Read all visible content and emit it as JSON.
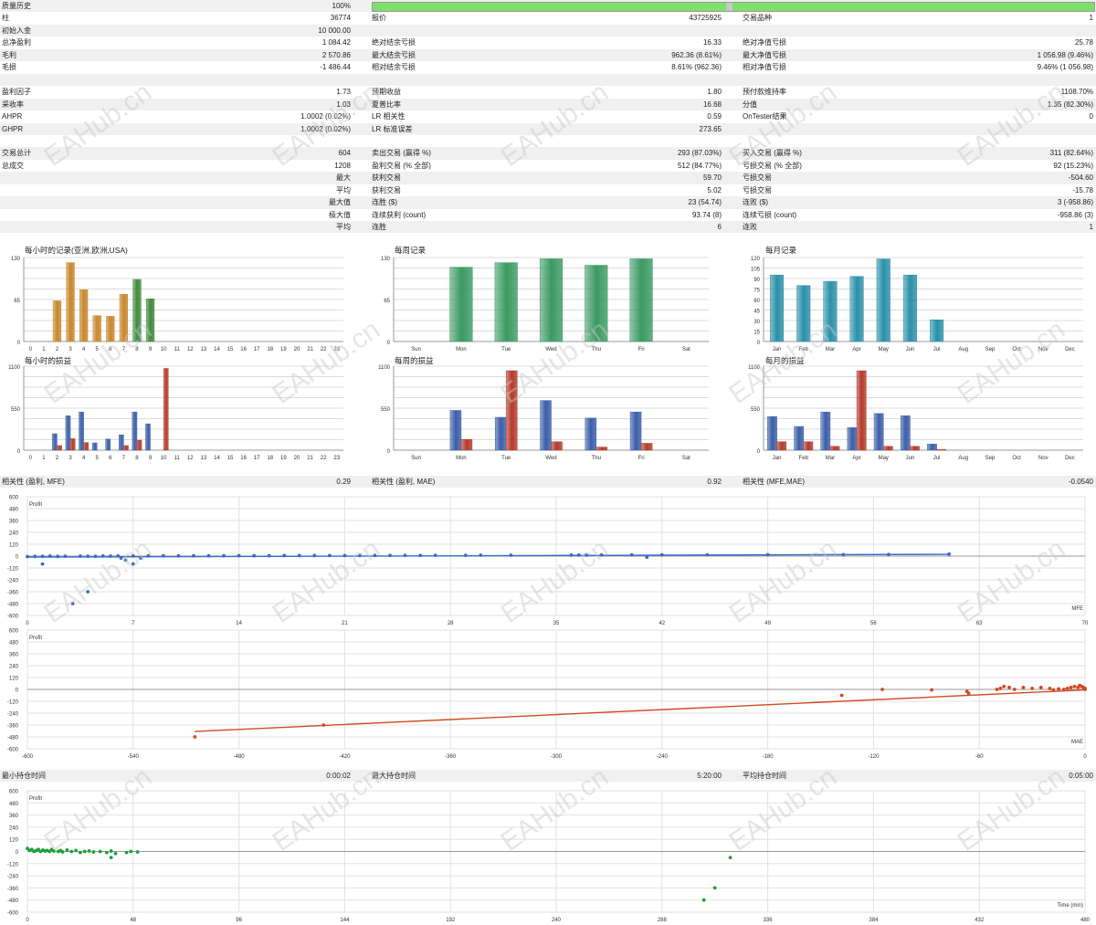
{
  "stats_rows": [
    {
      "cells": [
        [
          "质量历史",
          "100%"
        ],
        [
          "",
          ""
        ],
        [
          "",
          ""
        ]
      ],
      "alt": true
    },
    {
      "cells": [
        [
          "柱",
          "36774"
        ],
        [
          "报价",
          "43725925"
        ],
        [
          "交易品种",
          "1"
        ]
      ],
      "alt": false
    },
    {
      "cells": [
        [
          "初始入金",
          "10 000.00"
        ],
        [
          "",
          ""
        ],
        [
          "",
          ""
        ]
      ],
      "alt": true
    },
    {
      "cells": [
        [
          "总净盈利",
          "1 084.42"
        ],
        [
          "绝对结余亏损",
          "16.33"
        ],
        [
          "绝对净值亏损",
          "25.78"
        ]
      ],
      "alt": false
    },
    {
      "cells": [
        [
          "毛利",
          "2 570.86"
        ],
        [
          "最大结余亏损",
          "962.36 (8.61%)"
        ],
        [
          "最大净值亏损",
          "1 056.98 (9.46%)"
        ]
      ],
      "alt": true
    },
    {
      "cells": [
        [
          "毛损",
          "-1 486.44"
        ],
        [
          "相对结余亏损",
          "8.61% (962.36)"
        ],
        [
          "相对净值亏损",
          "9.46% (1 056.98)"
        ]
      ],
      "alt": false
    },
    {
      "cells": [
        [
          "",
          ""
        ],
        [
          "",
          ""
        ],
        [
          "",
          ""
        ]
      ],
      "alt": true
    },
    {
      "cells": [
        [
          "盈利因子",
          "1.73"
        ],
        [
          "预期收益",
          "1.80"
        ],
        [
          "预付款维持率",
          "1108.70%"
        ]
      ],
      "alt": false
    },
    {
      "cells": [
        [
          "采收率",
          "1.03"
        ],
        [
          "夏普比率",
          "16.68"
        ],
        [
          "分值",
          "1.35 (82.30%)"
        ]
      ],
      "alt": true
    },
    {
      "cells": [
        [
          "AHPR",
          "1.0002 (0.02%)"
        ],
        [
          "LR 相关性",
          "0.59"
        ],
        [
          "OnTester结果",
          "0"
        ]
      ],
      "alt": false
    },
    {
      "cells": [
        [
          "GHPR",
          "1.0002 (0.02%)"
        ],
        [
          "LR 标准误差",
          "273.65"
        ],
        [
          "",
          ""
        ]
      ],
      "alt": true
    },
    {
      "cells": [
        [
          "",
          ""
        ],
        [
          "",
          ""
        ],
        [
          "",
          ""
        ]
      ],
      "alt": false
    },
    {
      "cells": [
        [
          "交易总计",
          "604"
        ],
        [
          "卖出交易 (赢得 %)",
          "293 (87.03%)"
        ],
        [
          "买入交易 (赢得 %)",
          "311 (82.64%)"
        ]
      ],
      "alt": true
    },
    {
      "cells": [
        [
          "总成交",
          "1208"
        ],
        [
          "盈利交易 (% 全部)",
          "512 (84.77%)"
        ],
        [
          "亏损交易 (% 全部)",
          "92 (15.23%)"
        ]
      ],
      "alt": false
    },
    {
      "cells": [
        [
          "",
          "最大"
        ],
        [
          "获利交易",
          "59.70"
        ],
        [
          "亏损交易",
          "-504.60"
        ]
      ],
      "alt": true
    },
    {
      "cells": [
        [
          "",
          "平均"
        ],
        [
          "获利交易",
          "5.02"
        ],
        [
          "亏损交易",
          "-15.78"
        ]
      ],
      "alt": false
    },
    {
      "cells": [
        [
          "",
          "最大值"
        ],
        [
          "连胜 ($)",
          "23 (54.74)"
        ],
        [
          "连败 ($)",
          "3 (-958.86)"
        ]
      ],
      "alt": true
    },
    {
      "cells": [
        [
          "",
          "极大值"
        ],
        [
          "连续获利 (count)",
          "93.74 (8)"
        ],
        [
          "连续亏损 (count)",
          "-958.86 (3)"
        ]
      ],
      "alt": false
    },
    {
      "cells": [
        [
          "",
          "平均"
        ],
        [
          "连胜",
          "6"
        ],
        [
          "连败",
          "1"
        ]
      ],
      "alt": true
    }
  ],
  "quality_fill_percent": 100,
  "charts_top": {
    "titles": [
      "每小时的记录(亚洲,欧洲,USA)",
      "每周记录",
      "每月记录"
    ],
    "titles2": [
      "每小时的损益",
      "每周的损益",
      "每月的损益"
    ]
  },
  "chart_data": [
    {
      "type": "bar",
      "name_id": "hourly-records",
      "categories": [
        "0",
        "1",
        "2",
        "3",
        "4",
        "5",
        "6",
        "7",
        "8",
        "9",
        "10",
        "11",
        "12",
        "13",
        "14",
        "15",
        "16",
        "17",
        "18",
        "19",
        "20",
        "21",
        "22",
        "23"
      ],
      "values": [
        0,
        0,
        63,
        122,
        80,
        40,
        39,
        73,
        96,
        66,
        0,
        0,
        0,
        0,
        0,
        0,
        0,
        0,
        0,
        0,
        0,
        0,
        0,
        0
      ],
      "colors": [
        "#c8862a",
        "#c8862a",
        "#c8862a",
        "#c8862a",
        "#c8862a",
        "#c8862a",
        "#c8862a",
        "#c8862a",
        "#3d8a3d",
        "#3d8a3d",
        "#3d8a3d",
        "#3d8a3d",
        "#3d8a3d",
        "#3d8a3d",
        "#3d8a3d",
        "#3d8a3d",
        "#3d8a3d",
        "#3d8a3d",
        "#3d8a3d",
        "#3d8a3d",
        "#3d8a3d",
        "#3d8a3d",
        "#3d8a3d",
        "#3d8a3d"
      ],
      "yticks": [
        "0",
        "65",
        "130"
      ],
      "ylim": [
        0,
        130
      ]
    },
    {
      "type": "bar",
      "name_id": "weekly-records",
      "categories": [
        "Sun",
        "Mon",
        "Tue",
        "Wed",
        "Thu",
        "Fri",
        "Sat"
      ],
      "values": [
        0,
        115,
        122,
        128,
        118,
        128,
        0
      ],
      "color": "#3a9a62",
      "yticks": [
        "0",
        "65",
        "130"
      ],
      "ylim": [
        0,
        130
      ]
    },
    {
      "type": "bar",
      "name_id": "monthly-records",
      "categories": [
        "Jan",
        "Feb",
        "Mar",
        "Apr",
        "May",
        "Jun",
        "Jul",
        "Aug",
        "Sep",
        "Oct",
        "Nov",
        "Dec"
      ],
      "values": [
        95,
        80,
        86,
        93,
        118,
        95,
        31,
        0,
        0,
        0,
        0,
        0
      ],
      "color": "#2a90a8",
      "yticks": [
        "0",
        "15",
        "30",
        "45",
        "60",
        "75",
        "90",
        "105",
        "120"
      ],
      "ylim": [
        0,
        120
      ]
    },
    {
      "type": "bar",
      "name_id": "hourly-pnl",
      "categories": [
        "0",
        "1",
        "2",
        "3",
        "4",
        "5",
        "6",
        "7",
        "8",
        "9",
        "10",
        "11",
        "12",
        "13",
        "14",
        "15",
        "16",
        "17",
        "18",
        "19",
        "20",
        "21",
        "22",
        "23"
      ],
      "series": [
        {
          "values": [
            0,
            0,
            215,
            450,
            500,
            95,
            145,
            200,
            500,
            345,
            0,
            0,
            0,
            0,
            0,
            0,
            0,
            0,
            0,
            0,
            0,
            0,
            0,
            0
          ],
          "color": "#3a5ea8"
        },
        {
          "values": [
            0,
            0,
            60,
            150,
            100,
            0,
            0,
            60,
            130,
            0,
            1070,
            0,
            0,
            0,
            0,
            0,
            0,
            0,
            0,
            0,
            0,
            0,
            0,
            0
          ],
          "color": "#b33a2a"
        }
      ],
      "yticks": [
        "0",
        "550",
        "1100"
      ],
      "ylim": [
        0,
        1100
      ]
    },
    {
      "type": "bar",
      "name_id": "weekly-pnl",
      "categories": [
        "Sun",
        "Mon",
        "Tue",
        "Wed",
        "Thu",
        "Fri",
        "Sat"
      ],
      "series": [
        {
          "values": [
            0,
            520,
            430,
            650,
            420,
            500,
            0
          ],
          "color": "#3a5ea8"
        },
        {
          "values": [
            0,
            140,
            1040,
            110,
            40,
            90,
            0
          ],
          "color": "#b33a2a"
        }
      ],
      "yticks": [
        "0",
        "550",
        "1100"
      ],
      "ylim": [
        0,
        1100
      ]
    },
    {
      "type": "bar",
      "name_id": "monthly-pnl",
      "categories": [
        "Jan",
        "Feb",
        "Mar",
        "Apr",
        "May",
        "Jun",
        "Jul",
        "Aug",
        "Sep",
        "Oct",
        "Nov",
        "Dec"
      ],
      "series": [
        {
          "values": [
            440,
            310,
            500,
            295,
            480,
            450,
            80,
            0,
            0,
            0,
            0,
            0
          ],
          "color": "#3a5ea8"
        },
        {
          "values": [
            110,
            110,
            50,
            1040,
            50,
            50,
            10,
            0,
            0,
            0,
            0,
            0
          ],
          "color": "#b33a2a"
        }
      ],
      "yticks": [
        "0",
        "550",
        "1100"
      ],
      "ylim": [
        0,
        1100
      ]
    },
    {
      "type": "scatter",
      "name_id": "profit-mfe",
      "xlabel": "MFE",
      "ylabel": "Profit",
      "xticks": [
        "0",
        "7",
        "14",
        "21",
        "28",
        "35",
        "42",
        "49",
        "56",
        "63",
        "70"
      ],
      "xlim": [
        0,
        70
      ],
      "yticks": [
        "600",
        "480",
        "360",
        "240",
        "120",
        "0",
        "-120",
        "-240",
        "-360",
        "-480",
        "-600"
      ],
      "ylim": [
        -600,
        600
      ],
      "color": "#3a6ac8",
      "points": [
        [
          0,
          -5
        ],
        [
          0.5,
          -3
        ],
        [
          1,
          -2
        ],
        [
          1,
          -80
        ],
        [
          1.5,
          0
        ],
        [
          2,
          -3
        ],
        [
          2.5,
          -1
        ],
        [
          3,
          -480
        ],
        [
          3.5,
          0
        ],
        [
          4,
          -1
        ],
        [
          4,
          -360
        ],
        [
          4.5,
          -2
        ],
        [
          5,
          1
        ],
        [
          5.5,
          0
        ],
        [
          6,
          1
        ],
        [
          6.2,
          -20
        ],
        [
          6.5,
          -40
        ],
        [
          7,
          2
        ],
        [
          7,
          -80
        ],
        [
          7.5,
          -20
        ],
        [
          8,
          2
        ],
        [
          9,
          3
        ],
        [
          10,
          3
        ],
        [
          11,
          3
        ],
        [
          12,
          3
        ],
        [
          13,
          4
        ],
        [
          14,
          4
        ],
        [
          15,
          4
        ],
        [
          16,
          4
        ],
        [
          17,
          5
        ],
        [
          18,
          5
        ],
        [
          19,
          5
        ],
        [
          20,
          6
        ],
        [
          21,
          6
        ],
        [
          22,
          6
        ],
        [
          23,
          7
        ],
        [
          24,
          7
        ],
        [
          25,
          7
        ],
        [
          26,
          7
        ],
        [
          27,
          8
        ],
        [
          29,
          8
        ],
        [
          30,
          9
        ],
        [
          32,
          9
        ],
        [
          36,
          10
        ],
        [
          36.5,
          10
        ],
        [
          37,
          10
        ],
        [
          38,
          11
        ],
        [
          40,
          12
        ],
        [
          41,
          -10
        ],
        [
          42,
          12
        ],
        [
          45,
          13
        ],
        [
          49,
          14
        ],
        [
          54,
          15
        ],
        [
          57,
          16
        ],
        [
          61,
          20
        ]
      ],
      "trend": [
        [
          0,
          -10
        ],
        [
          61,
          18
        ]
      ]
    },
    {
      "type": "scatter",
      "name_id": "profit-mae",
      "xlabel": "MAE",
      "ylabel": "Profit",
      "xticks": [
        "-600",
        "-540",
        "-480",
        "-420",
        "-360",
        "-300",
        "-240",
        "-180",
        "-120",
        "-60",
        "0"
      ],
      "xlim": [
        -600,
        0
      ],
      "yticks": [
        "600",
        "480",
        "360",
        "240",
        "120",
        "0",
        "-120",
        "-240",
        "-360",
        "-480",
        "-600"
      ],
      "ylim": [
        -600,
        600
      ],
      "color": "#d04a22",
      "points": [
        [
          -505,
          -480
        ],
        [
          -432,
          -360
        ],
        [
          -138,
          -60
        ],
        [
          -115,
          0
        ],
        [
          -87,
          -5
        ],
        [
          -67,
          -20
        ],
        [
          -66,
          -40
        ],
        [
          -50,
          0
        ],
        [
          -48,
          10
        ],
        [
          -46,
          30
        ],
        [
          -43,
          20
        ],
        [
          -40,
          0
        ],
        [
          -35,
          20
        ],
        [
          -30,
          10
        ],
        [
          -25,
          20
        ],
        [
          -20,
          10
        ],
        [
          -15,
          5
        ],
        [
          -10,
          10
        ],
        [
          -8,
          20
        ],
        [
          -6,
          30
        ],
        [
          -4,
          20
        ],
        [
          -3,
          40
        ],
        [
          -2,
          30
        ],
        [
          -1,
          20
        ],
        [
          0,
          10
        ],
        [
          0,
          0
        ],
        [
          -12,
          0
        ],
        [
          -18,
          -5
        ]
      ],
      "trend": [
        [
          -505,
          -425
        ],
        [
          0,
          -5
        ]
      ]
    },
    {
      "type": "scatter",
      "name_id": "profit-time",
      "xlabel": "Time (min)",
      "ylabel": "Profit",
      "xticks": [
        "0",
        "48",
        "96",
        "144",
        "192",
        "240",
        "288",
        "336",
        "384",
        "432",
        "480"
      ],
      "xlim": [
        0,
        480
      ],
      "yticks": [
        "600",
        "480",
        "360",
        "240",
        "120",
        "0",
        "-120",
        "-240",
        "-360",
        "-480",
        "-600"
      ],
      "ylim": [
        -600,
        600
      ],
      "color": "#1e9e3a",
      "points": [
        [
          0,
          30
        ],
        [
          1,
          10
        ],
        [
          2,
          20
        ],
        [
          3,
          0
        ],
        [
          4,
          10
        ],
        [
          5,
          20
        ],
        [
          6,
          0
        ],
        [
          7,
          15
        ],
        [
          8,
          5
        ],
        [
          9,
          10
        ],
        [
          10,
          0
        ],
        [
          11,
          20
        ],
        [
          12,
          5
        ],
        [
          14,
          0
        ],
        [
          15,
          10
        ],
        [
          16,
          -5
        ],
        [
          18,
          15
        ],
        [
          20,
          0
        ],
        [
          22,
          10
        ],
        [
          24,
          -10
        ],
        [
          26,
          0
        ],
        [
          28,
          5
        ],
        [
          30,
          -5
        ],
        [
          33,
          0
        ],
        [
          36,
          -10
        ],
        [
          38,
          5
        ],
        [
          40,
          -20
        ],
        [
          45,
          -10
        ],
        [
          47,
          0
        ],
        [
          50,
          -5
        ],
        [
          38,
          -60
        ],
        [
          307,
          -480
        ],
        [
          312,
          -360
        ],
        [
          319,
          -60
        ]
      ]
    }
  ],
  "middle_band": [
    [
      "相关性 (盈利, MFE)",
      "0.29"
    ],
    [
      "相关性 (盈利, MAE)",
      "0.92"
    ],
    [
      "相关性 (MFE,MAE)",
      "-0.0540"
    ]
  ],
  "bottom_band": [
    [
      "最小持仓时间",
      "0:00:02"
    ],
    [
      "最大持仓时间",
      "5:20:00"
    ],
    [
      "平均持仓时间",
      "0:05:00"
    ]
  ],
  "watermark_text": "EAHub.cn"
}
